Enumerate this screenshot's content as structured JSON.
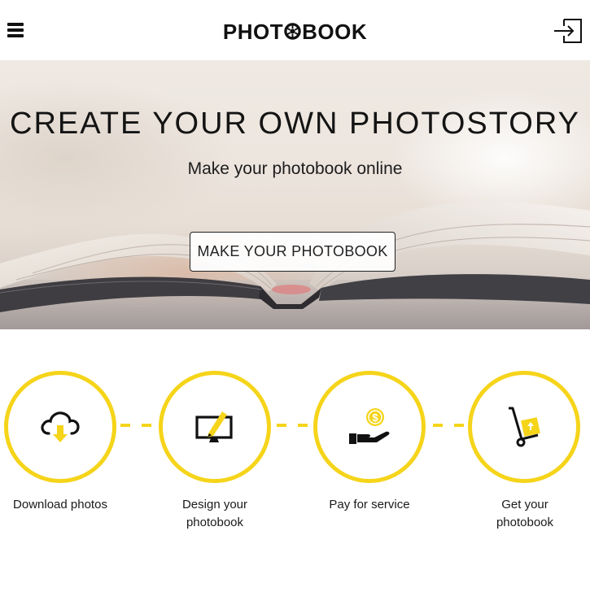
{
  "header": {
    "logo_part1": "PHOT",
    "logo_part2": "BOOK",
    "menu_icon": "hamburger-menu-icon",
    "login_icon": "sign-in-arrow-icon"
  },
  "hero": {
    "title": "CREATE YOUR OWN PHOTOSTORY",
    "subtitle": "Make your photobook online",
    "cta_label": "MAKE YOUR PHOTOBOOK"
  },
  "steps": [
    {
      "label": "Download photos",
      "icon": "cloud-download-icon"
    },
    {
      "label": "Design your photobook",
      "icon": "monitor-pen-icon"
    },
    {
      "label": "Pay for service",
      "icon": "hand-coin-icon"
    },
    {
      "label": "Get your photobook",
      "icon": "hand-truck-box-icon"
    }
  ],
  "colors": {
    "accent": "#f5d41a",
    "text": "#111111",
    "background": "#ffffff"
  }
}
